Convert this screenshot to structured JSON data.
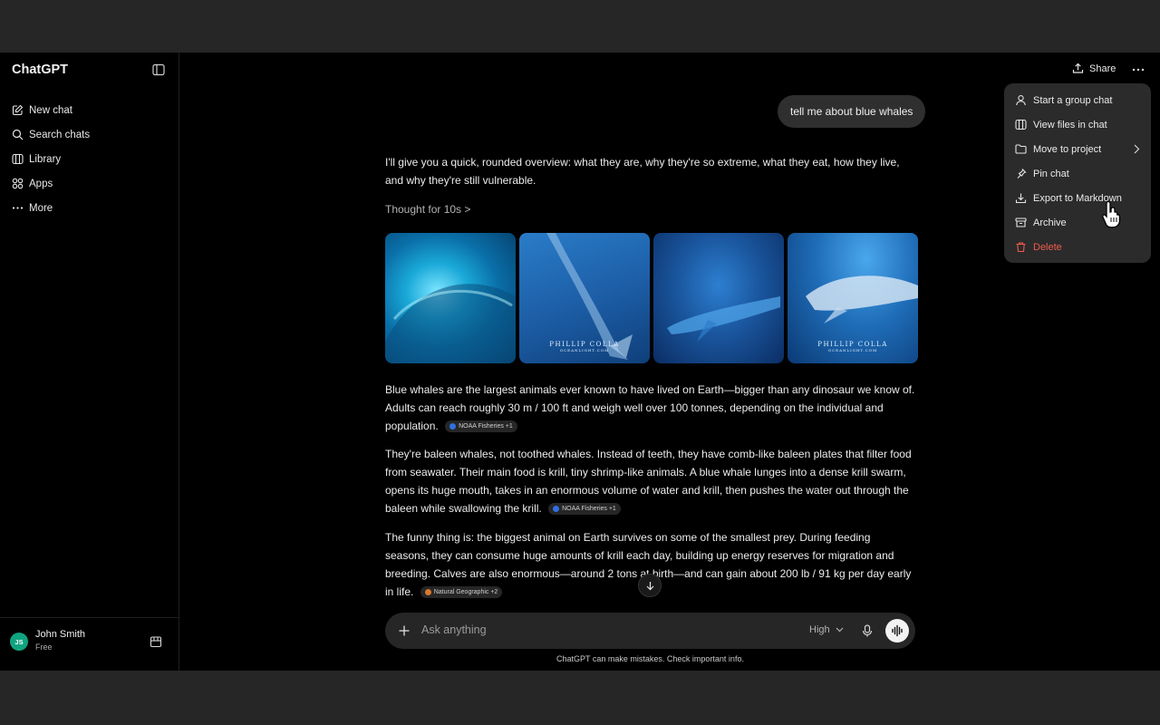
{
  "sidebar": {
    "brand": "ChatGPT",
    "nav": [
      {
        "label": "New chat",
        "icon": "compose-icon"
      },
      {
        "label": "Search chats",
        "icon": "search-icon"
      },
      {
        "label": "Library",
        "icon": "library-icon"
      },
      {
        "label": "Apps",
        "icon": "apps-icon"
      },
      {
        "label": "More",
        "icon": "more-dots-icon"
      }
    ],
    "user": {
      "initials": "JS",
      "name": "John Smith",
      "plan": "Free"
    }
  },
  "header": {
    "share_label": "Share"
  },
  "conversation": {
    "user_message": "tell me about blue whales",
    "intro": "I'll give you a quick, rounded overview: what they are, why they're so extreme, what they eat, how they live, and why they're still vulnerable.",
    "thought": "Thought for 10s >",
    "images": [
      {
        "watermark": "",
        "watermark_sub": ""
      },
      {
        "watermark": "PHILLIP COLLA",
        "watermark_sub": "OCEANLIGHT.COM"
      },
      {
        "watermark": "",
        "watermark_sub": ""
      },
      {
        "watermark": "PHILLIP COLLA",
        "watermark_sub": "OCEANLIGHT.COM"
      }
    ],
    "paragraphs": [
      {
        "text": "Blue whales are the largest animals ever known to have lived on Earth—bigger than any dinosaur we know of. Adults can reach roughly 30 m / 100 ft and weigh well over 100 tonnes, depending on the individual and population.",
        "citation": "NOAA Fisheries +1"
      },
      {
        "text": "They're baleen whales, not toothed whales. Instead of teeth, they have comb-like baleen plates that filter food from seawater. Their main food is krill, tiny shrimp-like animals. A blue whale lunges into a dense krill swarm, opens its huge mouth, takes in an enormous volume of water and krill, then pushes the water out through the baleen while swallowing the krill.",
        "citation": "NOAA Fisheries +1"
      },
      {
        "text": "The funny thing is: the biggest animal on Earth survives on some of the smallest prey. During feeding seasons, they can consume huge amounts of krill each day, building up energy reserves for migration and breeding. Calves are also enormous—around 2 tons at birth—and can gain about 200 lb / 91 kg per day early in life.",
        "citation": "Natural Geographic +2"
      }
    ]
  },
  "composer": {
    "placeholder": "Ask anything",
    "mode": "High"
  },
  "disclaimer": "ChatGPT can make mistakes. Check important info.",
  "menu": {
    "items": [
      {
        "label": "Start a group chat",
        "icon": "person-icon"
      },
      {
        "label": "View files in chat",
        "icon": "files-icon"
      },
      {
        "label": "Move to project",
        "icon": "folder-icon"
      },
      {
        "label": "Pin chat",
        "icon": "pin-icon"
      },
      {
        "label": "Export to Markdown",
        "icon": "download-icon"
      },
      {
        "label": "Archive",
        "icon": "archive-icon"
      },
      {
        "label": "Delete",
        "icon": "trash-icon"
      }
    ]
  },
  "colors": {
    "accent_user": "#10a37f",
    "danger": "#ef5a4c",
    "bubble": "#2f2f2f",
    "menu_bg": "#2b2b2b"
  }
}
